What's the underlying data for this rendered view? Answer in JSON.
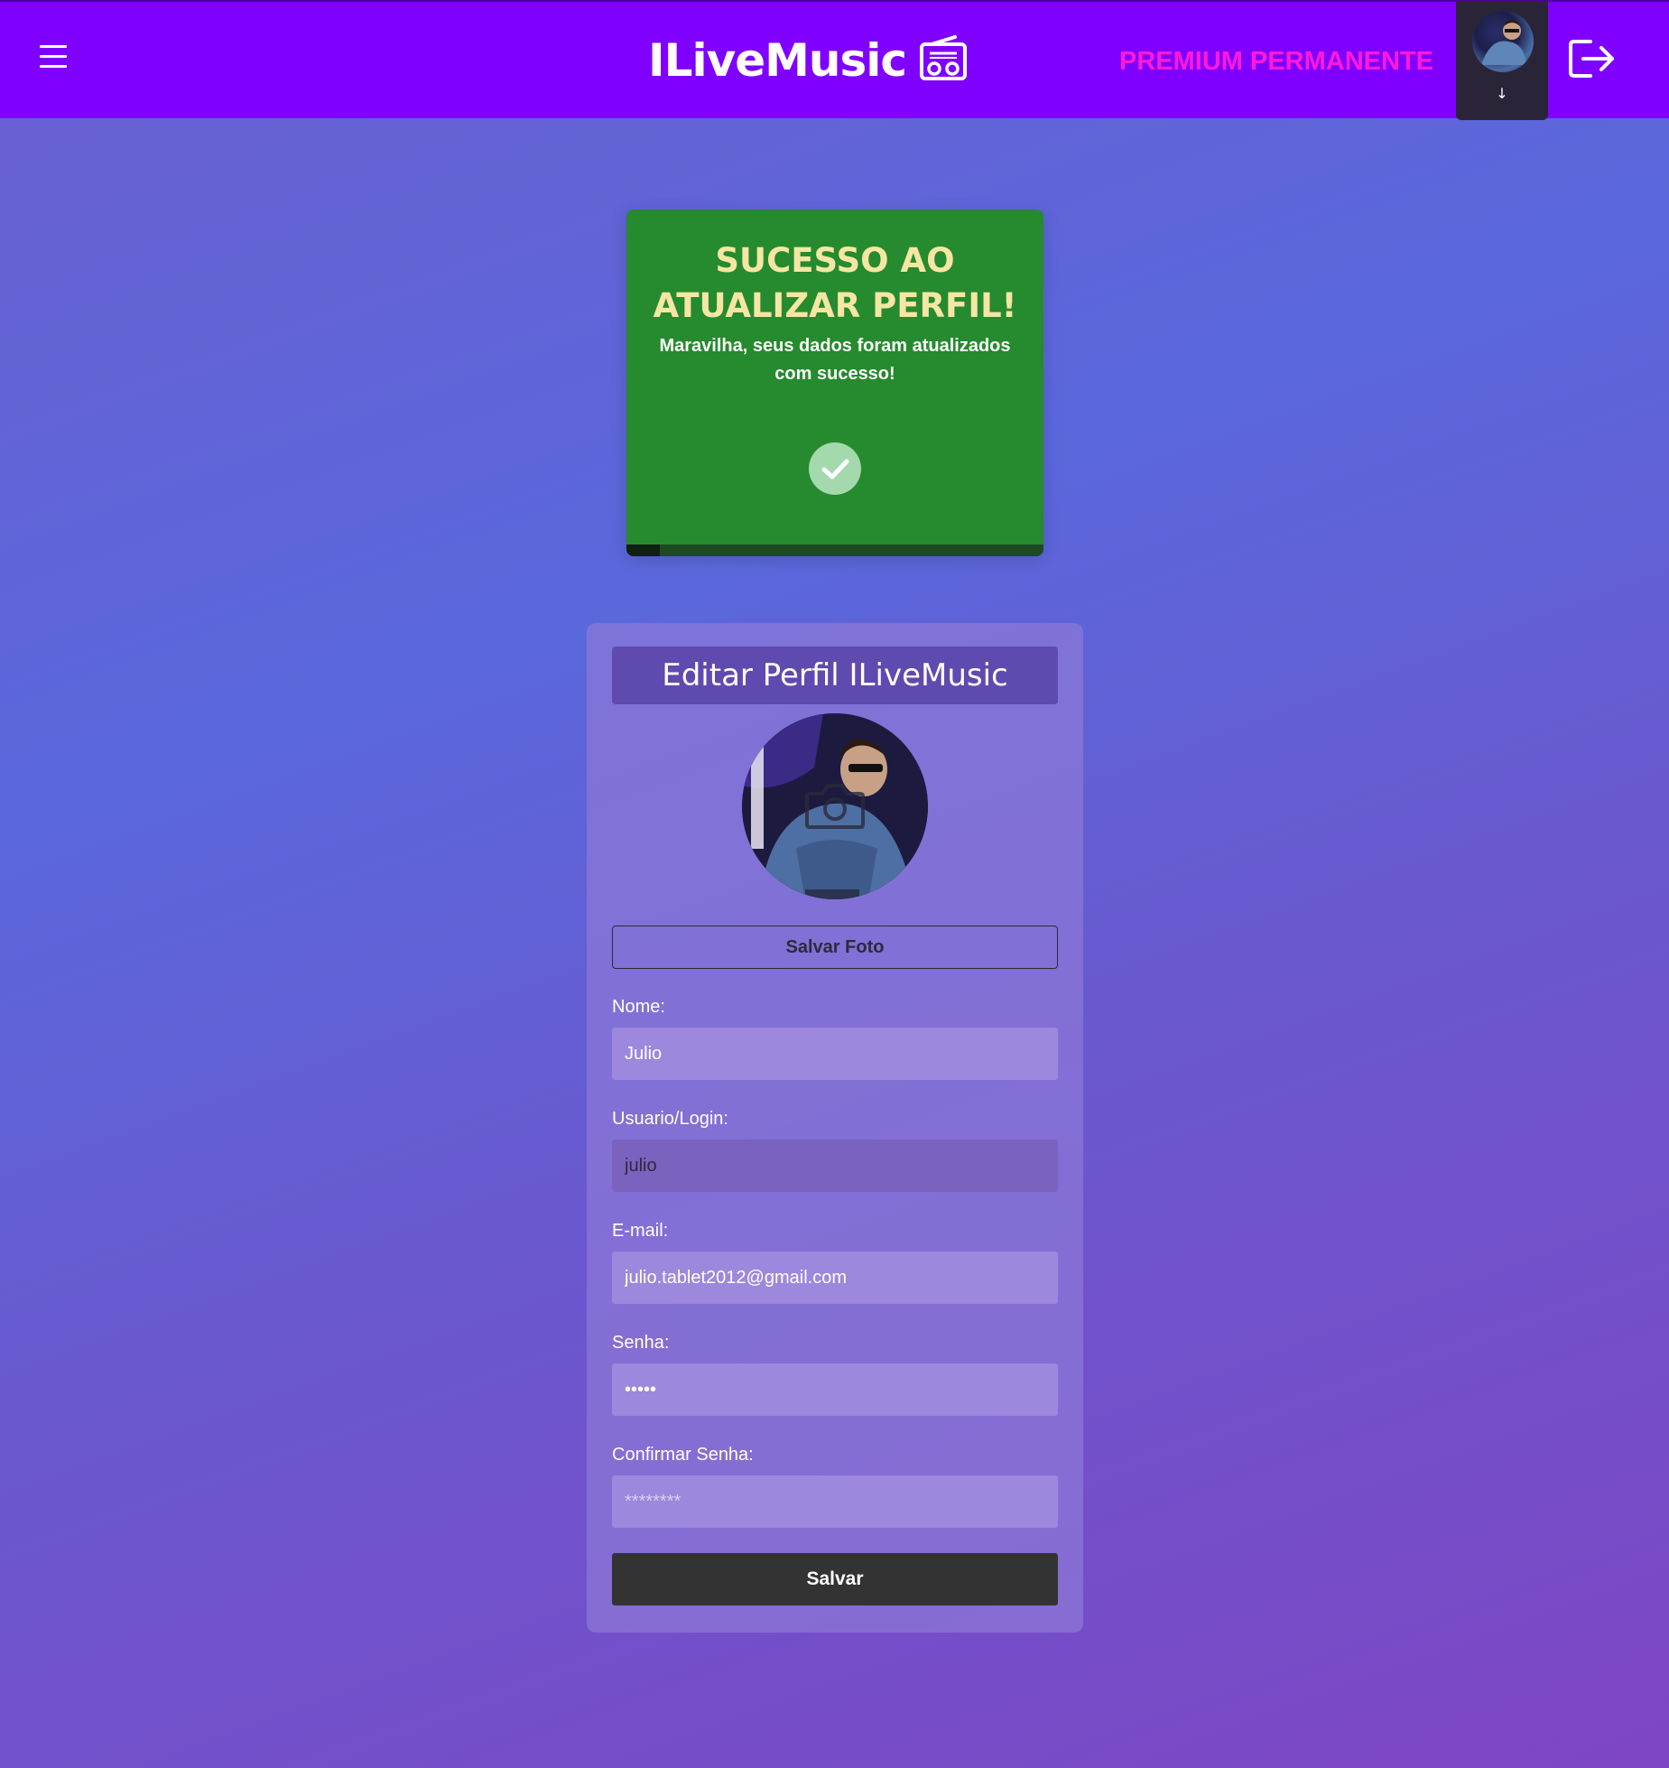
{
  "header": {
    "brand_title": "ILiveMusic",
    "brand_icon": "radio-icon",
    "premium_label": "PREMIUM PERMANENTE",
    "avatar_arrow": "↓",
    "logout_icon": "logout-icon",
    "menu_icon": "hamburger-menu-icon"
  },
  "toast": {
    "title": "SUCESSO AO ATUALIZAR PERFIL!",
    "message": "Maravilha, seus dados foram atualizados com sucesso!",
    "icon": "check-circle-icon",
    "progress": 0.08
  },
  "profile_form": {
    "title": "Editar Perfil ILiveMusic",
    "photo_overlay_icon": "camera-icon",
    "save_photo_label": "Salvar Foto",
    "fields": [
      {
        "label": "Nome:",
        "value": "Julio",
        "placeholder": ""
      },
      {
        "label": "Usuario/Login:",
        "value": "julio",
        "placeholder": ""
      },
      {
        "label": "E-mail:",
        "value": "julio.tablet2012@gmail.com",
        "placeholder": ""
      },
      {
        "label": "Senha:",
        "value": "•••••",
        "placeholder": ""
      },
      {
        "label": "Confirmar Senha:",
        "value": "",
        "placeholder": "********"
      }
    ],
    "save_label": "Salvar"
  },
  "colors": {
    "header_bg": "#8000ff",
    "premium": "#ff1ad9",
    "toast_bg": "#268a2e",
    "toast_title": "#f5e6a3",
    "save_button": "#333333"
  }
}
